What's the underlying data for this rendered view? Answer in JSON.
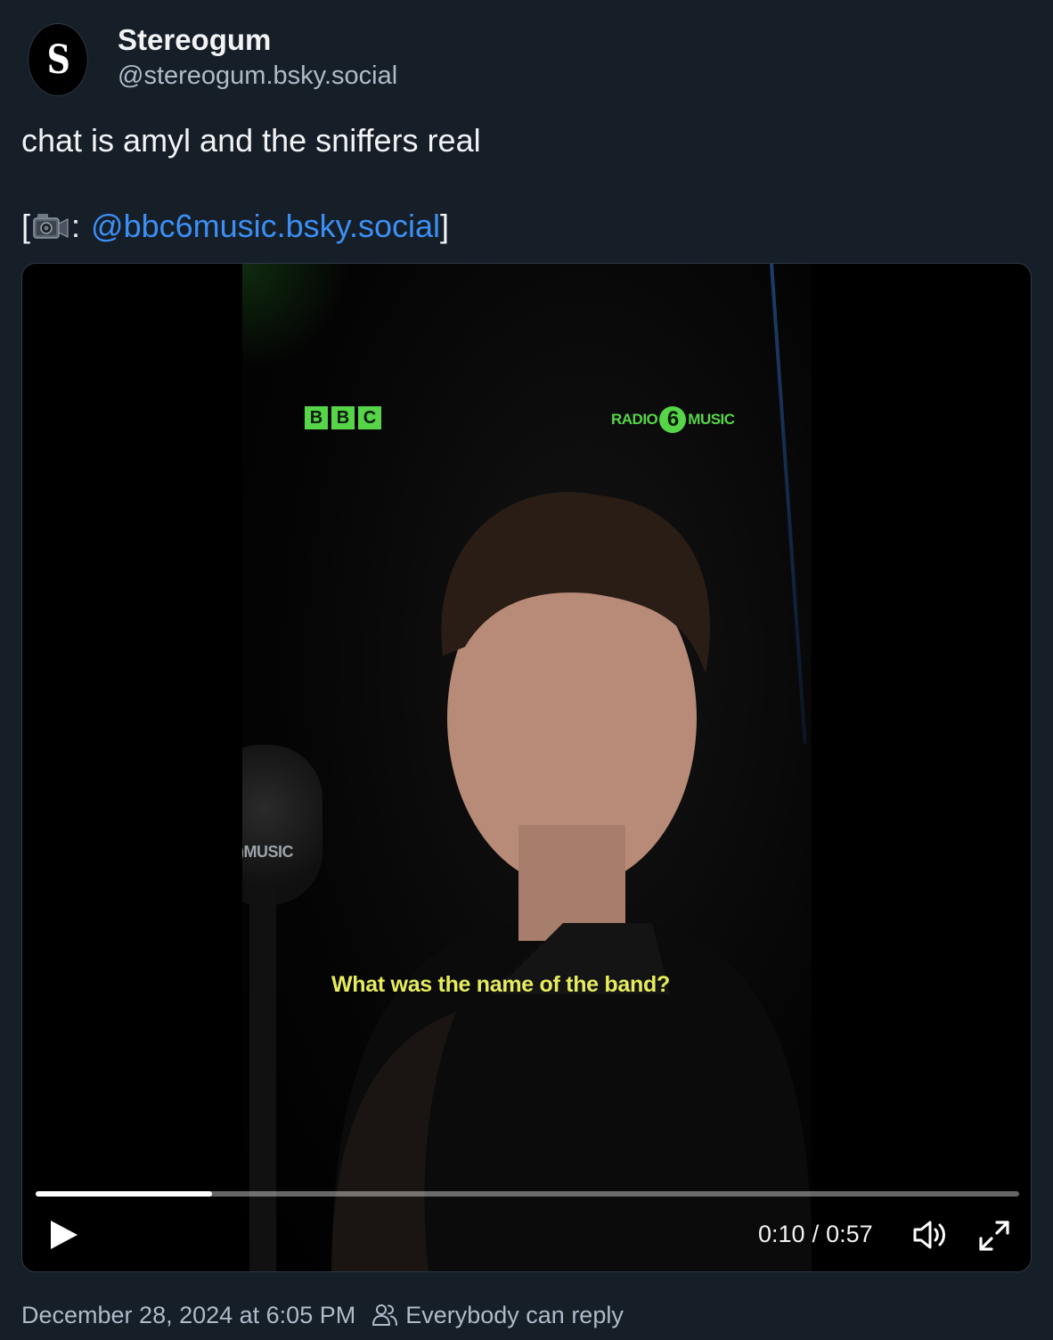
{
  "author": {
    "avatar_letter": "S",
    "display_name": "Stereogum",
    "handle": "@stereogum.bsky.social"
  },
  "post": {
    "text": "chat is amyl and the sniffers real",
    "credit_open": "[",
    "credit_icon": "video-camera-icon",
    "credit_sep": ":",
    "mention": "@bbc6music.bsky.social",
    "credit_close": "]"
  },
  "video": {
    "overlay": {
      "bbc_letters": [
        "B",
        "B",
        "C"
      ],
      "radio_left": "RADIO",
      "radio_number": "6",
      "radio_right": "MUSIC",
      "mic_label": ")MUSIC",
      "caption": "What was the name of the band?"
    },
    "progress_fraction": 0.179,
    "current_time": "0:10",
    "time_separator": "/",
    "duration": "0:57",
    "colors": {
      "accent_green": "#56d548",
      "caption_yellow": "#e6ec5a"
    }
  },
  "footer": {
    "timestamp": "December 28, 2024 at 6:05 PM",
    "reply_setting": "Everybody can reply"
  },
  "colors": {
    "background": "#161e27",
    "text": "#f1f3f5",
    "secondary_text": "#aebbc9",
    "link": "#3b8ff5"
  }
}
